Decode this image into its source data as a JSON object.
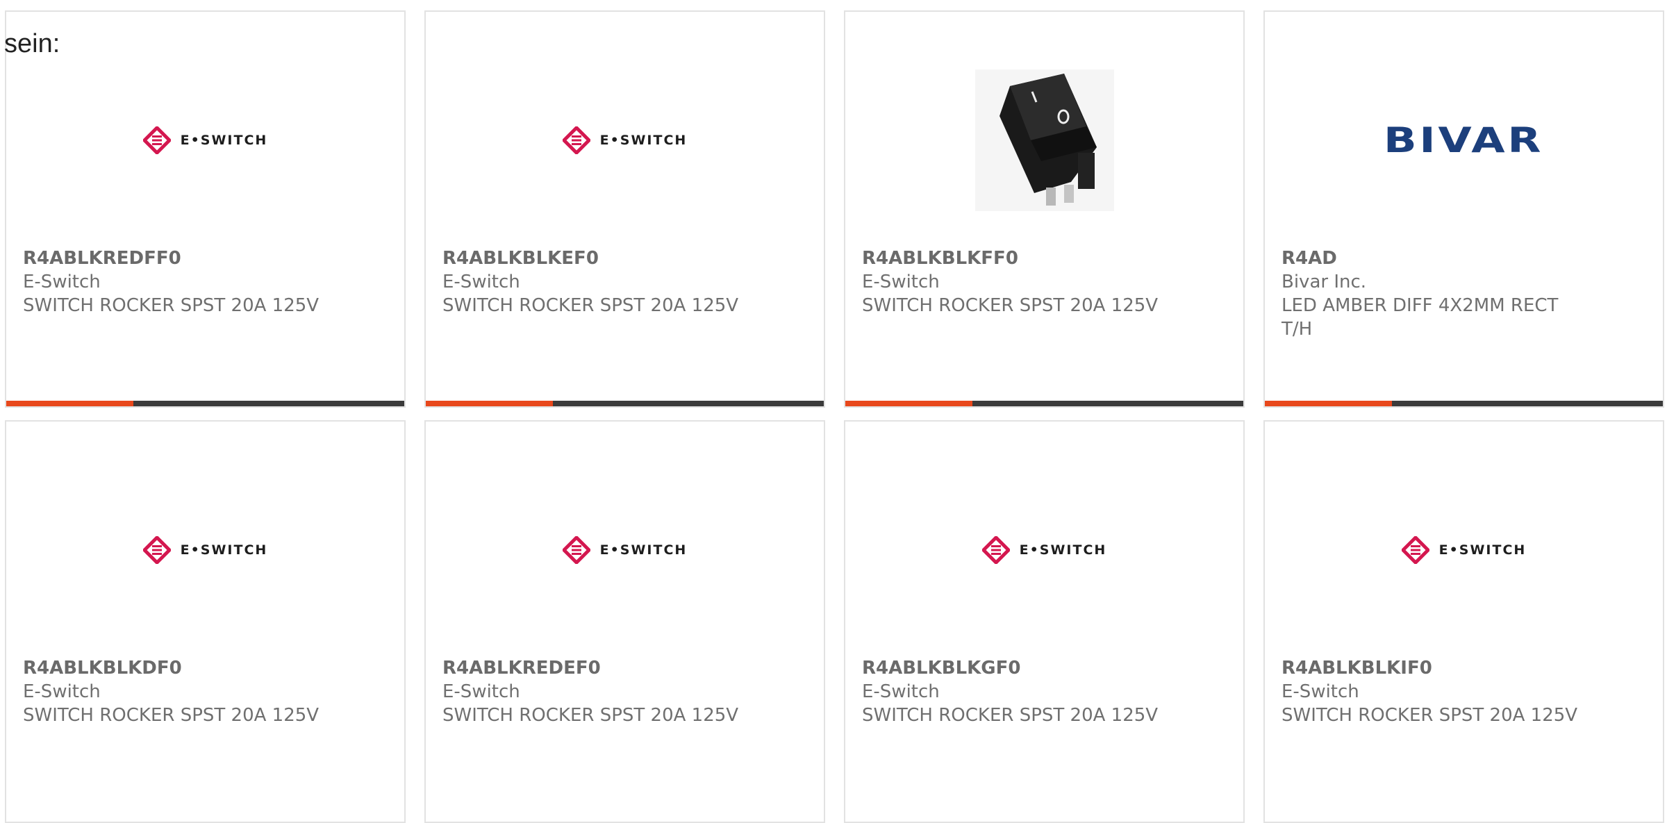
{
  "intro_text": "sein:",
  "colors": {
    "accent": "#e8481c",
    "bar_bg": "#3b3b3b",
    "eswitch_red": "#d4174f",
    "bivar_blue": "#1c3f7c"
  },
  "products": [
    {
      "part": "R4ABLKREDFF0",
      "manufacturer": "E-Switch",
      "description": "SWITCH ROCKER SPST 20A 125V",
      "image": "eswitch-logo",
      "logo_text": "E•SWITCH"
    },
    {
      "part": "R4ABLKBLKEF0",
      "manufacturer": "E-Switch",
      "description": "SWITCH ROCKER SPST 20A 125V",
      "image": "eswitch-logo",
      "logo_text": "E•SWITCH"
    },
    {
      "part": "R4ABLKBLKFF0",
      "manufacturer": "E-Switch",
      "description": "SWITCH ROCKER SPST 20A 125V",
      "image": "rocker-switch-photo"
    },
    {
      "part": "R4AD",
      "manufacturer": "Bivar Inc.",
      "description": "LED AMBER DIFF 4X2MM RECT T/H",
      "image": "bivar-logo",
      "logo_text": "BIVAR"
    },
    {
      "part": "R4ABLKBLKDF0",
      "manufacturer": "E-Switch",
      "description": "SWITCH ROCKER SPST 20A 125V",
      "image": "eswitch-logo",
      "logo_text": "E•SWITCH"
    },
    {
      "part": "R4ABLKREDEF0",
      "manufacturer": "E-Switch",
      "description": "SWITCH ROCKER SPST 20A 125V",
      "image": "eswitch-logo",
      "logo_text": "E•SWITCH"
    },
    {
      "part": "R4ABLKBLKGF0",
      "manufacturer": "E-Switch",
      "description": "SWITCH ROCKER SPST 20A 125V",
      "image": "eswitch-logo",
      "logo_text": "E•SWITCH"
    },
    {
      "part": "R4ABLKBLKIF0",
      "manufacturer": "E-Switch",
      "description": "SWITCH ROCKER SPST 20A 125V",
      "image": "eswitch-logo",
      "logo_text": "E•SWITCH"
    }
  ]
}
